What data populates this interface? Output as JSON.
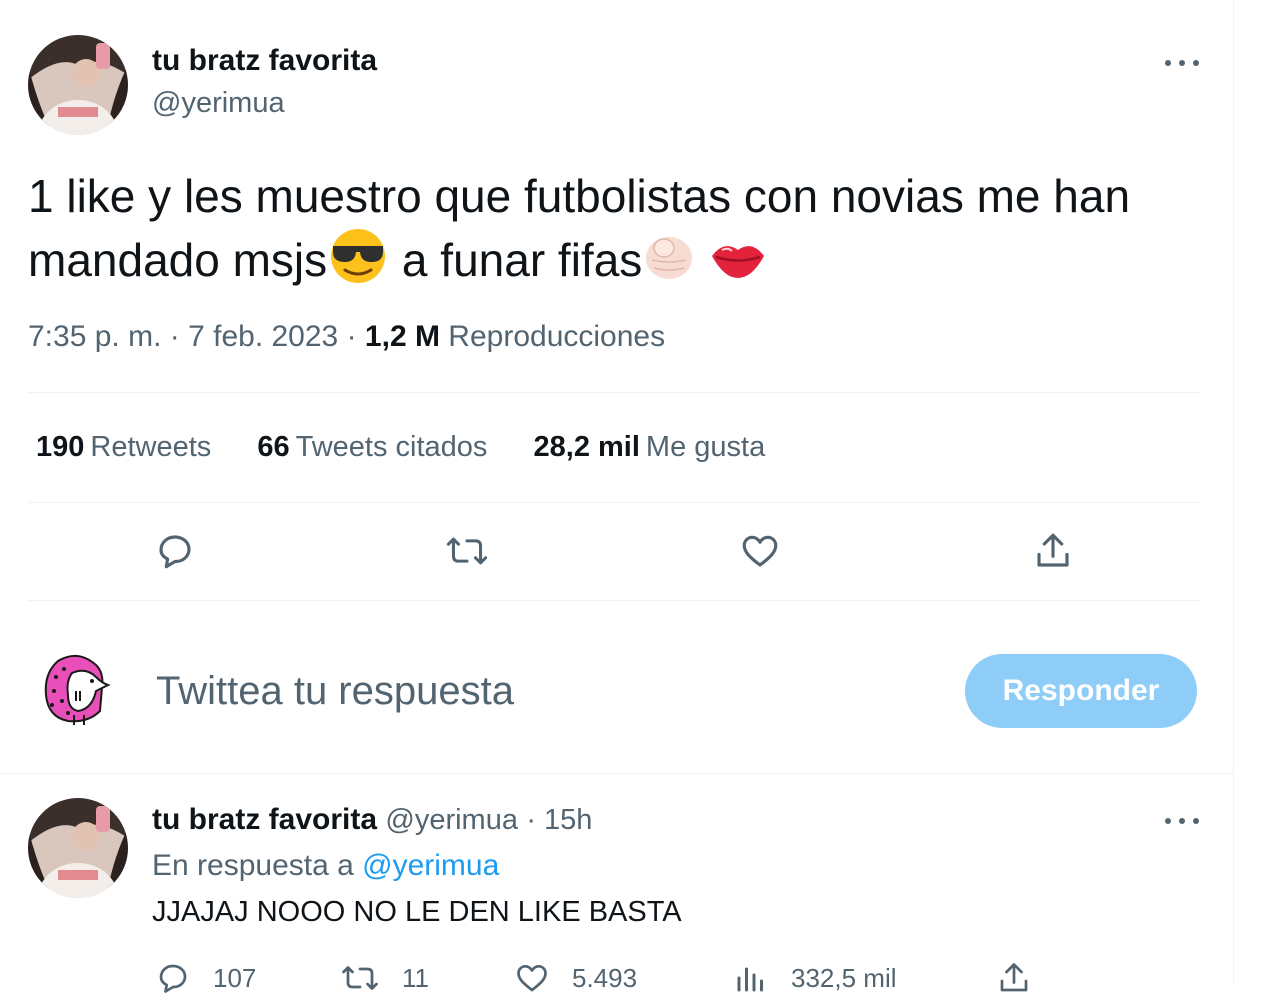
{
  "tweet": {
    "author_name": "tu bratz favorita",
    "author_handle": "@yerimua",
    "text_line1": "1 like y les muestro que futbolistas con novias me han",
    "text_line2_a": "mandado msjs",
    "text_line2_b": " a funar fifas",
    "emojis": [
      "smiling-face-with-sunglasses",
      "backhand-index-pointing-at-viewer",
      "kiss-mark"
    ],
    "time": "7:35 p. m.",
    "date": "7 feb. 2023",
    "separator": "·",
    "views_count": "1,2 M",
    "views_label": "Reproducciones"
  },
  "stats": {
    "retweets_count": "190",
    "retweets_label": "Retweets",
    "quotes_count": "66",
    "quotes_label": "Tweets citados",
    "likes_count": "28,2 mil",
    "likes_label": "Me gusta"
  },
  "compose": {
    "placeholder": "Twittea tu respuesta",
    "button_label": "Responder"
  },
  "reply": {
    "author_name": "tu bratz favorita",
    "author_handle": "@yerimua",
    "time_ago": "· 15h",
    "replying_prefix": "En respuesta a",
    "replying_to": "@yerimua",
    "text": "JJAJAJ NOOO NO LE DEN LIKE BASTA",
    "reply_count": "107",
    "retweet_count": "11",
    "like_count": "5.493",
    "view_count": "332,5 mil"
  },
  "colors": {
    "accent": "#1d9bf0",
    "button_disabled": "#8ecdf8",
    "secondary_text": "#536471",
    "divider": "#eff3f4"
  }
}
